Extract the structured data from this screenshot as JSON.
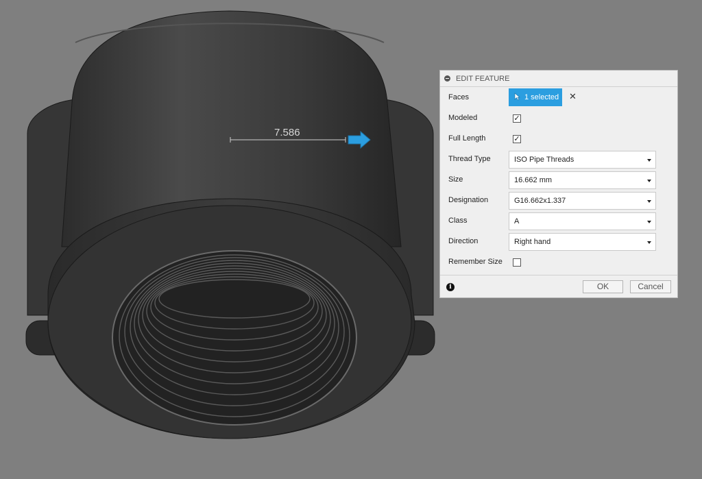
{
  "viewport": {
    "dimension_value": "7.586",
    "model_color": "#3a3a3a",
    "background_color": "#7f7f7f",
    "arrow_color": "#2b9ee0"
  },
  "panel": {
    "title": "EDIT FEATURE",
    "faces": {
      "label": "Faces",
      "selection": "1 selected"
    },
    "modeled": {
      "label": "Modeled",
      "checked": true
    },
    "full_length": {
      "label": "Full Length",
      "checked": true
    },
    "thread_type": {
      "label": "Thread Type",
      "value": "ISO Pipe Threads"
    },
    "size": {
      "label": "Size",
      "value": "16.662 mm"
    },
    "designation": {
      "label": "Designation",
      "value": "G16.662x1.337"
    },
    "class": {
      "label": "Class",
      "value": "A"
    },
    "direction": {
      "label": "Direction",
      "value": "Right hand"
    },
    "remember_size": {
      "label": "Remember Size",
      "checked": false
    },
    "ok_label": "OK",
    "cancel_label": "Cancel",
    "accent_color": "#2b9ee0"
  }
}
